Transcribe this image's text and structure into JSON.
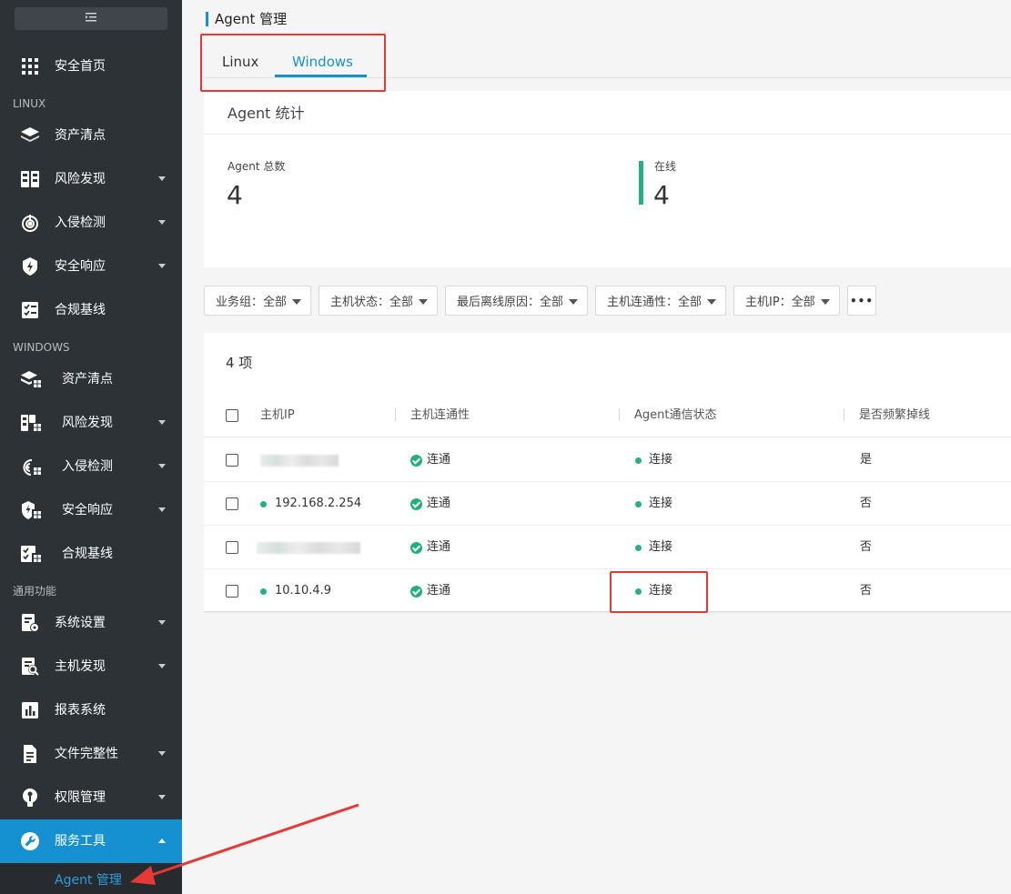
{
  "sidebar": {
    "collapse_icon": "menu-fold-icon",
    "home": {
      "label": "安全首页",
      "icon": "grid-icon"
    },
    "linux_section": "LINUX",
    "linux_items": [
      {
        "label": "资产清点",
        "icon": "layers-icon"
      },
      {
        "label": "风险发现",
        "icon": "risk-icon"
      },
      {
        "label": "入侵检测",
        "icon": "radar-icon"
      },
      {
        "label": "安全响应",
        "icon": "shield-bolt-icon"
      },
      {
        "label": "合规基线",
        "icon": "checklist-icon"
      }
    ],
    "windows_section": "WINDOWS",
    "windows_items": [
      {
        "label": "资产清点",
        "icon": "layers-windows-icon"
      },
      {
        "label": "风险发现",
        "icon": "risk-windows-icon"
      },
      {
        "label": "入侵检测",
        "icon": "radar-windows-icon"
      },
      {
        "label": "安全响应",
        "icon": "shield-windows-icon"
      },
      {
        "label": "合规基线",
        "icon": "checklist-windows-icon"
      }
    ],
    "general_section": "通用功能",
    "general_items": [
      {
        "label": "系统设置",
        "icon": "settings-doc-icon"
      },
      {
        "label": "主机发现",
        "icon": "host-search-icon"
      },
      {
        "label": "报表系统",
        "icon": "bar-chart-icon"
      },
      {
        "label": "文件完整性",
        "icon": "file-icon"
      },
      {
        "label": "权限管理",
        "icon": "key-icon"
      },
      {
        "label": "服务工具",
        "icon": "wrench-icon"
      }
    ],
    "active_sub_item": "Agent 管理"
  },
  "page": {
    "title": "Agent 管理",
    "tabs": [
      "Linux",
      "Windows"
    ],
    "active_tab": "Windows"
  },
  "stats": {
    "title": "Agent 统计",
    "total_label": "Agent 总数",
    "total_value": "4",
    "online_label": "在线",
    "online_value": "4"
  },
  "filters": [
    {
      "label": "业务组：全部"
    },
    {
      "label": "主机状态：全部"
    },
    {
      "label": "最后离线原因：全部"
    },
    {
      "label": "主机连通性：全部"
    },
    {
      "label": "主机IP：全部"
    }
  ],
  "more_label": "•••",
  "table": {
    "count": "4 项",
    "columns": [
      "主机IP",
      "主机连通性",
      "Agent通信状态",
      "是否频繁掉线"
    ],
    "rows": [
      {
        "ip": "",
        "connectivity": "连通",
        "agent_status": "连接",
        "frequent_drop": "是"
      },
      {
        "ip": "192.168.2.254",
        "connectivity": "连通",
        "agent_status": "连接",
        "frequent_drop": "否"
      },
      {
        "ip": "",
        "connectivity": "连通",
        "agent_status": "连接",
        "frequent_drop": "否"
      },
      {
        "ip": "10.10.4.9",
        "connectivity": "连通",
        "agent_status": "连接",
        "frequent_drop": "否"
      }
    ]
  },
  "colors": {
    "sidebar_bg": "#2d3236",
    "accent": "#1591d1",
    "online_green": "#22b07d",
    "annotation_red": "#e53935"
  }
}
